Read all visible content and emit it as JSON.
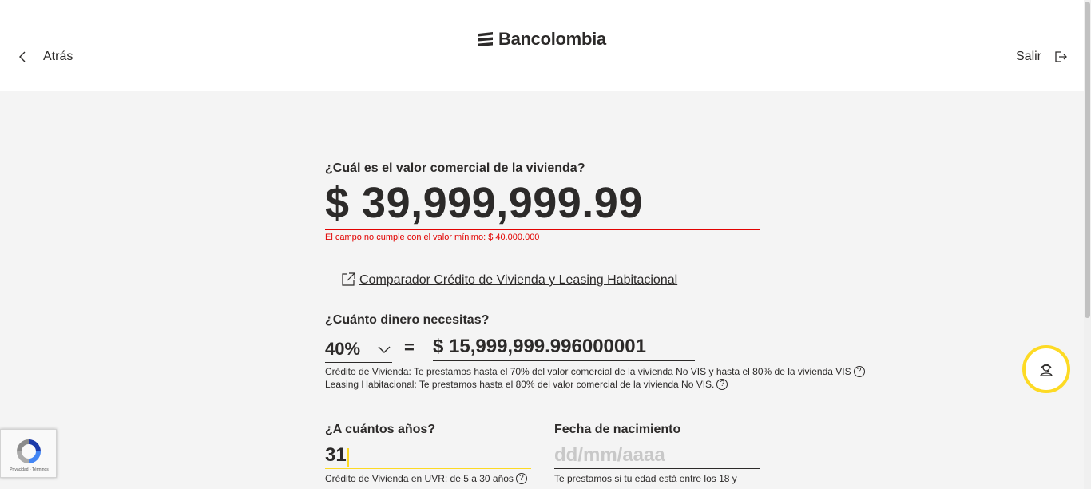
{
  "header": {
    "back_label": "Atrás",
    "brand": "Bancolombia",
    "exit_label": "Salir"
  },
  "property": {
    "question": "¿Cuál es el valor comercial de la vivienda?",
    "value": "$ 39,999,999.99",
    "error": "El campo no cumple con el valor mínimo: $ 40.000.000"
  },
  "comparator": {
    "label": " Comparador Crédito de Vivienda y Leasing Habitacional"
  },
  "loan": {
    "question": "¿Cuánto dinero necesitas?",
    "percent": "40%",
    "equals": "=",
    "amount": "$ 15,999,999.996000001",
    "note_credit": "Crédito de Vivienda: Te prestamos hasta el 70% del valor comercial de la vivienda No VIS y hasta el 80% de la vivienda VIS",
    "note_leasing": "Leasing Habitacional: Te prestamos hasta el 80% del valor comercial de la vivienda No VIS.",
    "help_glyph": "?"
  },
  "term": {
    "question": "¿A cuántos años?",
    "value": "31",
    "note": "Crédito de Vivienda en UVR: de 5 a 30 años"
  },
  "birth": {
    "question": "Fecha de nacimiento",
    "placeholder": "dd/mm/aaaa",
    "note": "Te prestamos si tu edad está entre los 18 y"
  },
  "recaptcha": {
    "links": "Privacidad - Términos"
  },
  "colors": {
    "accent_yellow": "#fdda24",
    "error_red": "#e20201",
    "text": "#2c2a29",
    "background": "#f4f4f4"
  }
}
